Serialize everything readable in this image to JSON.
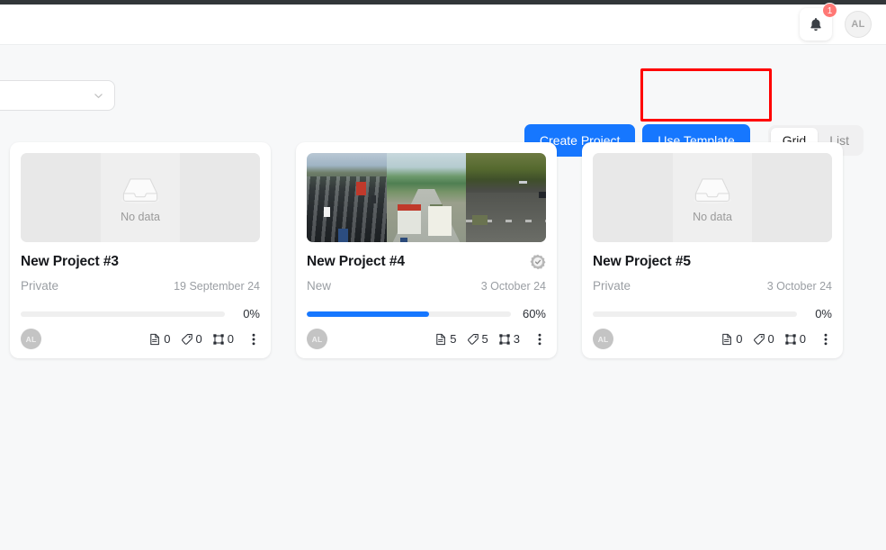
{
  "header": {
    "notification": {
      "icon": "bell-icon",
      "badge_count": "1"
    },
    "user_avatar": {
      "initials": "AL"
    }
  },
  "toolbar": {
    "filter_select": {
      "value": "",
      "chevron": "chevron-down-icon"
    },
    "create_project_label": "Create Project",
    "use_template_label": "Use Template",
    "view_toggle": {
      "options": [
        "Grid",
        "List"
      ],
      "grid_label": "Grid",
      "list_label": "List",
      "selected": "Grid"
    }
  },
  "annotation": {
    "target": "use-template-button",
    "color": "#ff0000"
  },
  "colors": {
    "primary": "#1677ff",
    "badge": "#ff7875",
    "highlight": "#ff0000",
    "muted_text": "#9a9ea3"
  },
  "projects": [
    {
      "title": "New Project #3",
      "visibility": "Private",
      "date": "19 September 24",
      "progress_pct": "0%",
      "progress_value": 0,
      "thumbnail": {
        "type": "empty",
        "empty_label": "No data"
      },
      "verified": false,
      "owner_initials": "AL",
      "stats": [
        {
          "icon": "document-icon",
          "value": "0"
        },
        {
          "icon": "tag-icon",
          "value": "0"
        },
        {
          "icon": "bounding-box-icon",
          "value": "0"
        }
      ]
    },
    {
      "title": "New Project #4",
      "visibility": "New",
      "date": "3 October 24",
      "progress_pct": "60%",
      "progress_value": 60,
      "thumbnail": {
        "type": "photos",
        "empty_label": ""
      },
      "verified": true,
      "owner_initials": "AL",
      "stats": [
        {
          "icon": "document-icon",
          "value": "5"
        },
        {
          "icon": "tag-icon",
          "value": "5"
        },
        {
          "icon": "bounding-box-icon",
          "value": "3"
        }
      ]
    },
    {
      "title": "New Project #5",
      "visibility": "Private",
      "date": "3 October 24",
      "progress_pct": "0%",
      "progress_value": 0,
      "thumbnail": {
        "type": "empty",
        "empty_label": "No data"
      },
      "verified": false,
      "owner_initials": "AL",
      "stats": [
        {
          "icon": "document-icon",
          "value": "0"
        },
        {
          "icon": "tag-icon",
          "value": "0"
        },
        {
          "icon": "bounding-box-icon",
          "value": "0"
        }
      ]
    }
  ]
}
